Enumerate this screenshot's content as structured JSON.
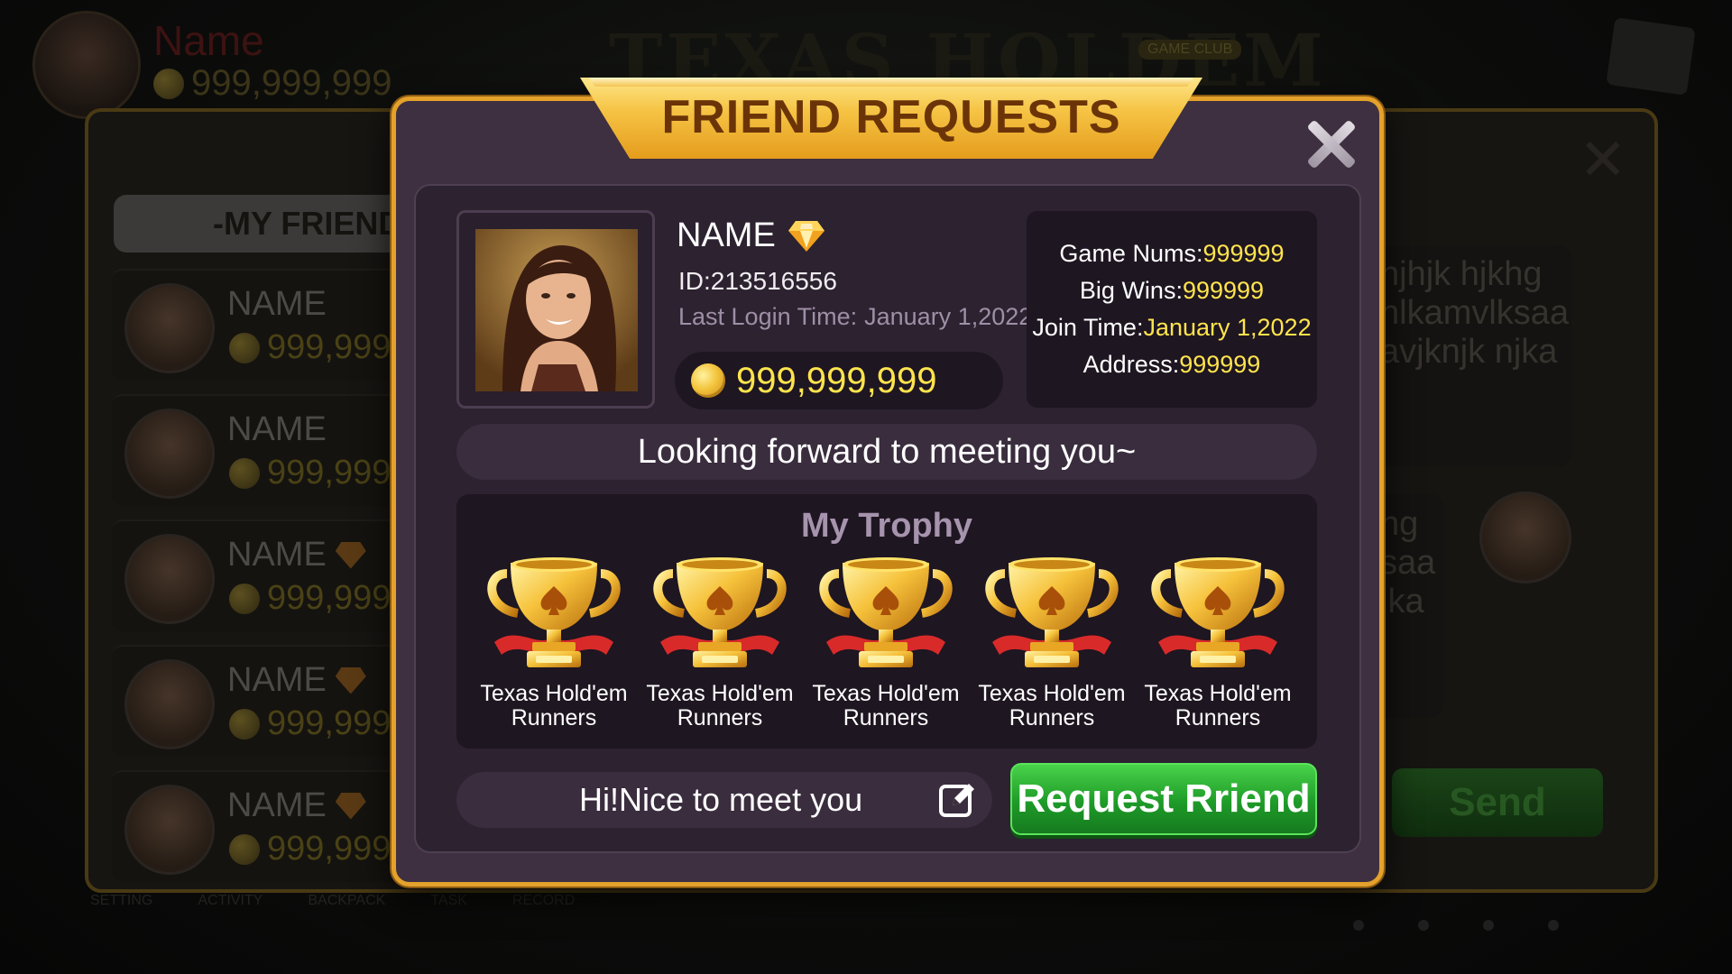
{
  "background": {
    "player_name": "Name",
    "player_coins": "999,999,999",
    "logo_text": "TEXAS HOLDEM",
    "logo_badge": "GAME CLUB",
    "friends_tab_label": "-MY FRIEND",
    "friends": [
      {
        "name": "NAME",
        "coins": "999,999,",
        "vip": false
      },
      {
        "name": "NAME",
        "coins": "999,999,",
        "vip": false
      },
      {
        "name": "NAME",
        "coins": "999,999,",
        "vip": true
      },
      {
        "name": "NAME",
        "coins": "999,999,",
        "vip": true
      },
      {
        "name": "NAME",
        "coins": "999,999,",
        "vip": true
      }
    ],
    "chat_text_1": "hjhjk hjkhg\nnlkamvlksaa\navjknjk njka",
    "chat_text_2": "hg\nsaa\njka",
    "send_label": "Send",
    "bottom_nav": [
      "SETTING",
      "ACTIVITY",
      "BACKPACK",
      "TASK",
      "RECORD"
    ]
  },
  "dialog": {
    "title": "FRIEND REQUESTS",
    "profile": {
      "name": "NAME",
      "id": "ID:213516556",
      "last_login_label": "Last Login Time:",
      "last_login_value": "January 1,2022",
      "coins": "999,999,999"
    },
    "stats": {
      "game_nums_label": "Game Nums:",
      "game_nums_value": "999999",
      "big_wins_label": "Big Wins:",
      "big_wins_value": "999999",
      "join_time_label": "Join Time:",
      "join_time_value": "January 1,2022",
      "address_label": "Address:",
      "address_value": "999999"
    },
    "motto": "Looking forward to meeting you~",
    "trophy_title": "My Trophy",
    "trophies": [
      {
        "line1": "Texas Hold'em",
        "line2": "Runners"
      },
      {
        "line1": "Texas Hold'em",
        "line2": "Runners"
      },
      {
        "line1": "Texas Hold'em",
        "line2": "Runners"
      },
      {
        "line1": "Texas Hold'em",
        "line2": "Runners"
      },
      {
        "line1": "Texas Hold'em",
        "line2": "Runners"
      }
    ],
    "message_value": "Hi!Nice to meet you",
    "request_button_label": "Request Rriend"
  },
  "colors": {
    "accent_gold": "#e4a12b",
    "value_yellow": "#ffe44d",
    "button_green": "#1e9b28",
    "dialog_purple": "#3e3040"
  }
}
